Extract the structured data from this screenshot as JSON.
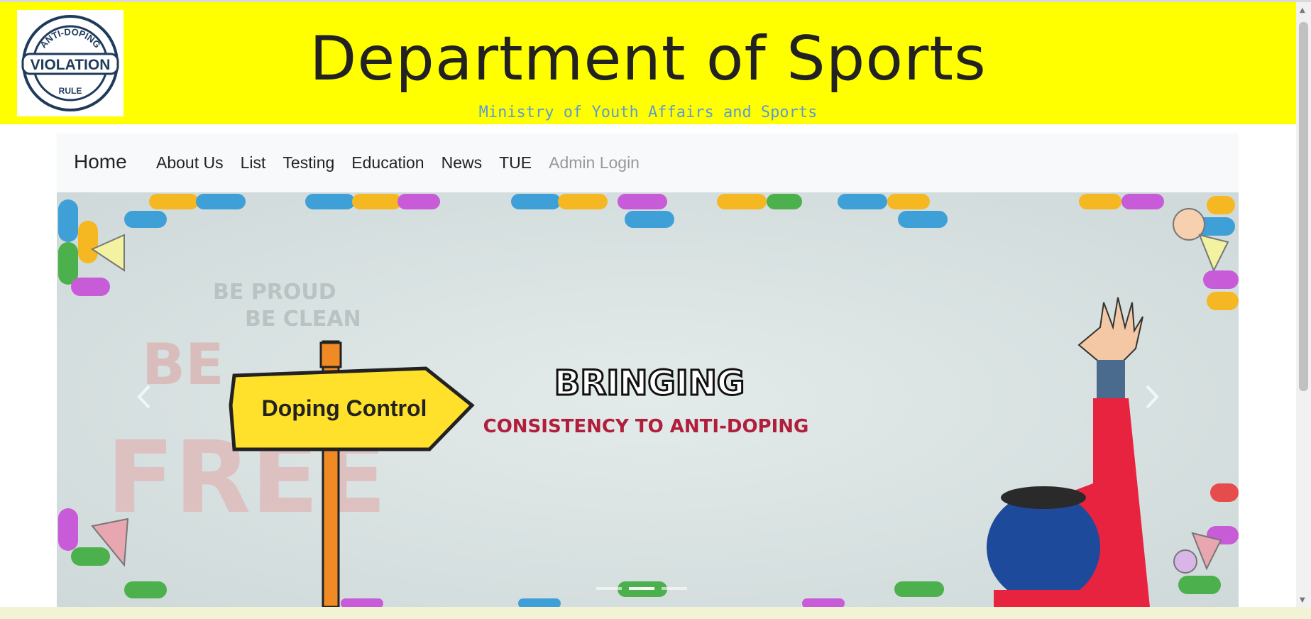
{
  "header": {
    "logo": {
      "top_text": "ANTI-DOPING",
      "main_text": "VIOLATION",
      "bottom_text": "RULE",
      "color": "#1f3b5c"
    },
    "title": "Department of Sports",
    "subtitle": "Ministry of Youth Affairs and Sports",
    "background_color": "#ffff00"
  },
  "navbar": {
    "brand": "Home",
    "links": [
      {
        "label": "About Us"
      },
      {
        "label": "List"
      },
      {
        "label": "Testing"
      },
      {
        "label": "Education"
      },
      {
        "label": "News"
      },
      {
        "label": "TUE"
      },
      {
        "label": "Admin Login"
      }
    ]
  },
  "hero": {
    "sign_text": "Doping Control",
    "headline": "BRINGING",
    "tagline": "CONSISTENCY TO ANTI-DOPING",
    "background_words": [
      "BE PROUD",
      "BE CLEAN",
      "BE",
      "FREE"
    ],
    "prev_icon": "chevron-left-icon",
    "next_icon": "chevron-right-icon",
    "slides": 3,
    "active_slide": 1
  }
}
